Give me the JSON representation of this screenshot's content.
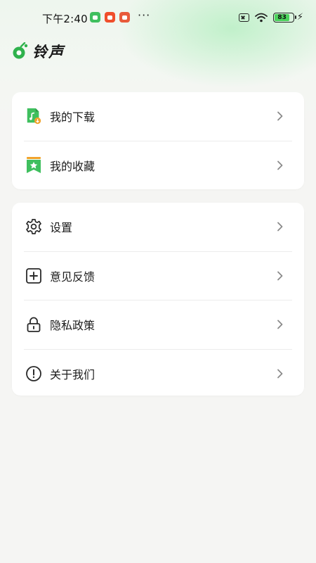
{
  "status_bar": {
    "time": "下午2:40",
    "battery_level": "83",
    "notification_icons": [
      "wechat-icon",
      "app-notification-icon",
      "mi-notification-icon"
    ]
  },
  "header": {
    "title": "铃声"
  },
  "colors": {
    "accent": "#3fbf5e",
    "card_bg": "#ffffff",
    "page_bg": "#f5f5f3",
    "favorite_orange": "#f0a32b"
  },
  "section1": {
    "items": [
      {
        "label": "我的下载",
        "icon": "music-download-icon"
      },
      {
        "label": "我的收藏",
        "icon": "bookmark-star-icon"
      }
    ]
  },
  "section2": {
    "items": [
      {
        "label": "设置",
        "icon": "gear-icon"
      },
      {
        "label": "意见反馈",
        "icon": "plus-box-icon"
      },
      {
        "label": "隐私政策",
        "icon": "lock-icon"
      },
      {
        "label": "关于我们",
        "icon": "info-circle-icon"
      }
    ]
  }
}
